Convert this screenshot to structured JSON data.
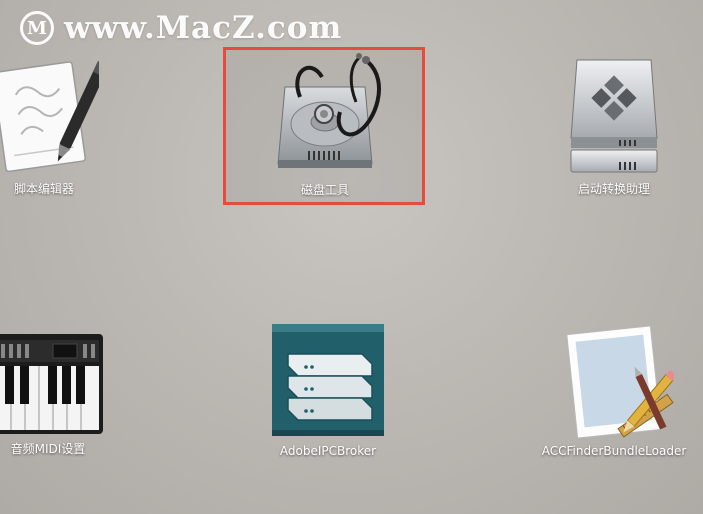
{
  "watermark": {
    "logo_letter": "M",
    "text": "www.MacZ.com"
  },
  "apps": [
    {
      "label": "脚本编辑器",
      "icon": "script-editor-icon"
    },
    {
      "label": "磁盘工具",
      "icon": "disk-utility-icon",
      "selected": true
    },
    {
      "label": "启动转换助理",
      "icon": "boot-camp-assistant-icon"
    },
    {
      "label": "音频MIDI设置",
      "icon": "audio-midi-setup-icon"
    },
    {
      "label": "AdobeIPCBroker",
      "icon": "adobe-ipc-broker-icon"
    },
    {
      "label": "ACCFinderBundleLoader",
      "icon": "acc-finder-bundle-loader-icon"
    }
  ],
  "colors": {
    "highlight_border": "#e64b3c",
    "label_text": "#ffffff"
  }
}
